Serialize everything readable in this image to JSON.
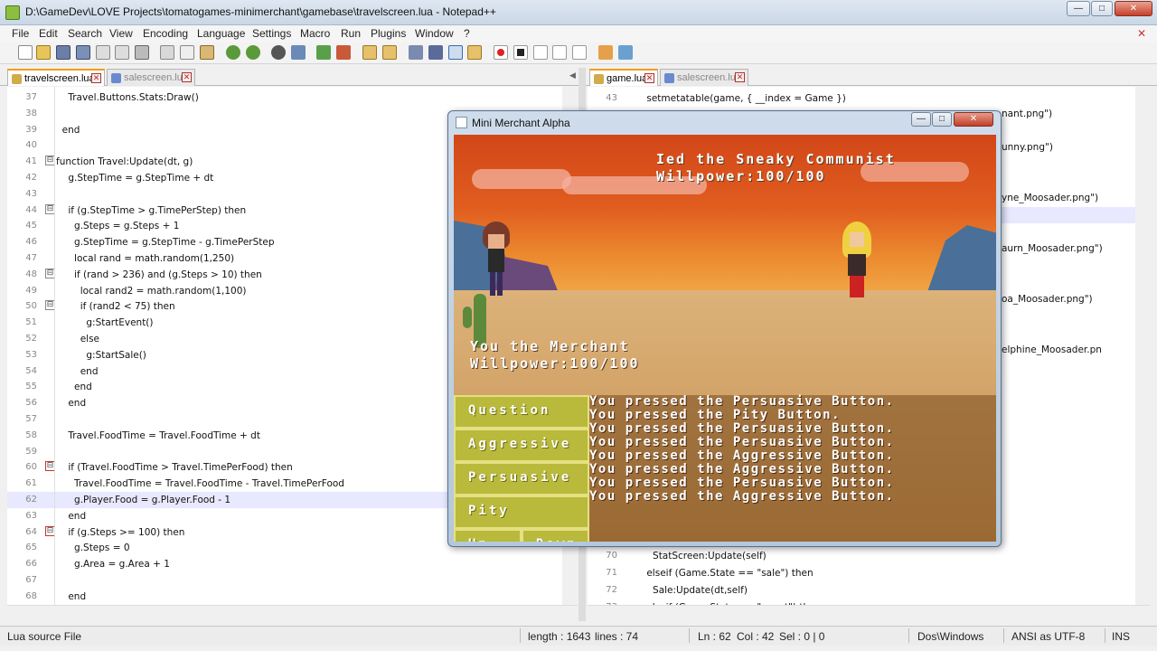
{
  "window": {
    "title": "D:\\GameDev\\LOVE Projects\\tomatogames-minimerchant\\gamebase\\travelscreen.lua - Notepad++",
    "min": "—",
    "max": "□",
    "close": "✕"
  },
  "menu": [
    "File",
    "Edit",
    "Search",
    "View",
    "Encoding",
    "Language",
    "Settings",
    "Macro",
    "Run",
    "Plugins",
    "Window",
    "?"
  ],
  "toolbar_icons": [
    "new-file-icon",
    "open-file-icon",
    "save-icon",
    "save-all-icon",
    "close-icon",
    "close-all-icon",
    "print-icon",
    "cut-icon",
    "copy-icon",
    "paste-icon",
    "undo-icon",
    "redo-icon",
    "find-icon",
    "replace-icon",
    "zoom-in-icon",
    "zoom-out-icon",
    "sync-v-icon",
    "sync-h-icon",
    "wrap-icon",
    "all-chars-icon",
    "indent-guide-icon",
    "doc-map-icon",
    "record-macro-icon",
    "stop-macro-icon",
    "play-macro-icon",
    "run-macro-icon",
    "save-macro-icon",
    "launch-icon",
    "spellcheck-icon"
  ],
  "left_tabs": [
    {
      "label": "travelscreen.lua",
      "active": true
    },
    {
      "label": "salescreen.lua",
      "active": false
    }
  ],
  "right_tabs": [
    {
      "label": "game.lua",
      "active": true
    },
    {
      "label": "salescreen.lua",
      "active": false
    }
  ],
  "left_lines": [
    {
      "n": "37",
      "fold": "",
      "code": "    Travel.Buttons.Stats:Draw()"
    },
    {
      "n": "38",
      "fold": "",
      "code": ""
    },
    {
      "n": "39",
      "fold": "",
      "code": "  end"
    },
    {
      "n": "40",
      "fold": "",
      "code": ""
    },
    {
      "n": "41",
      "fold": "⊟",
      "code": "function Travel:Update(dt, g)"
    },
    {
      "n": "42",
      "fold": "",
      "code": "    g.StepTime = g.StepTime + dt"
    },
    {
      "n": "43",
      "fold": "",
      "code": ""
    },
    {
      "n": "44",
      "fold": "⊟",
      "code": "    if (g.StepTime > g.TimePerStep) then"
    },
    {
      "n": "45",
      "fold": "",
      "code": "      g.Steps = g.Steps + 1"
    },
    {
      "n": "46",
      "fold": "",
      "code": "      g.StepTime = g.StepTime - g.TimePerStep"
    },
    {
      "n": "47",
      "fold": "",
      "code": "      local rand = math.random(1,250)"
    },
    {
      "n": "48",
      "fold": "⊟",
      "code": "      if (rand > 236) and (g.Steps > 10) then"
    },
    {
      "n": "49",
      "fold": "",
      "code": "        local rand2 = math.random(1,100)"
    },
    {
      "n": "50",
      "fold": "⊟",
      "code": "        if (rand2 < 75) then"
    },
    {
      "n": "51",
      "fold": "",
      "code": "          g:StartEvent()"
    },
    {
      "n": "52",
      "fold": "",
      "code": "        else"
    },
    {
      "n": "53",
      "fold": "",
      "code": "          g:StartSale()"
    },
    {
      "n": "54",
      "fold": "",
      "code": "        end"
    },
    {
      "n": "55",
      "fold": "",
      "code": "      end"
    },
    {
      "n": "56",
      "fold": "",
      "code": "    end"
    },
    {
      "n": "57",
      "fold": "",
      "code": ""
    },
    {
      "n": "58",
      "fold": "",
      "code": "    Travel.FoodTime = Travel.FoodTime + dt"
    },
    {
      "n": "59",
      "fold": "",
      "code": ""
    },
    {
      "n": "60",
      "fold": "⊟",
      "code": "    if (Travel.FoodTime > Travel.TimePerFood) then"
    },
    {
      "n": "61",
      "fold": "",
      "code": "      Travel.FoodTime = Travel.FoodTime - Travel.TimePerFood"
    },
    {
      "n": "62",
      "fold": "",
      "code": "      g.Player.Food = g.Player.Food - 1"
    },
    {
      "n": "63",
      "fold": "",
      "code": "    end"
    },
    {
      "n": "64",
      "fold": "⊟",
      "code": "    if (g.Steps >= 100) then"
    },
    {
      "n": "65",
      "fold": "",
      "code": "      g.Steps = 0"
    },
    {
      "n": "66",
      "fold": "",
      "code": "      g.Area = g.Area + 1"
    },
    {
      "n": "67",
      "fold": "",
      "code": ""
    },
    {
      "n": "68",
      "fold": "",
      "code": "    end"
    }
  ],
  "right_lines_top": [
    {
      "n": "43",
      "code": "    setmetatable(game, { __index = Game })"
    }
  ],
  "right_snippets": [
    "nant.png\")",
    "unny.png\")",
    "yne_Moosader.png\")",
    "aurn_Moosader.png\")",
    "oa_Moosader.png\")",
    "elphine_Moosader.pn"
  ],
  "right_lines_bottom": [
    {
      "n": "70",
      "code": "      StatScreen:Update(self)"
    },
    {
      "n": "71",
      "code": "    elseif (Game.State == \"sale\") then"
    },
    {
      "n": "72",
      "code": "      Sale:Update(dt,self)"
    },
    {
      "n": "73",
      "code": "    elseif (Game.State == \"event\") then"
    }
  ],
  "status": {
    "filetype": "Lua source File",
    "length": "length : 1643",
    "lines": "lines : 74",
    "ln": "Ln : 62",
    "col": "Col : 42",
    "sel": "Sel : 0 | 0",
    "eol": "Dos\\Windows",
    "encoding": "ANSI as UTF-8",
    "mode": "INS"
  },
  "game_window": {
    "title": "Mini Merchant Alpha",
    "enemy_name": "Ied the Sneaky Communist",
    "enemy_willpower": "Willpower:100/100",
    "player_name": "You the Merchant",
    "player_willpower": "Willpower:100/100",
    "buttons": {
      "question": "Question",
      "aggressive": "Aggressive",
      "persuasive": "Persuasive",
      "pity": "Pity",
      "up": "Up",
      "down": "Down"
    },
    "log": [
      "You pressed the Persuasive Button.",
      "You pressed the Pity Button.",
      "You pressed the Persuasive Button.",
      "You pressed the Persuasive Button.",
      "You pressed the Aggressive Button.",
      "You pressed the Aggressive Button.",
      "You pressed the Persuasive Button.",
      "You pressed the Aggressive Button."
    ]
  }
}
